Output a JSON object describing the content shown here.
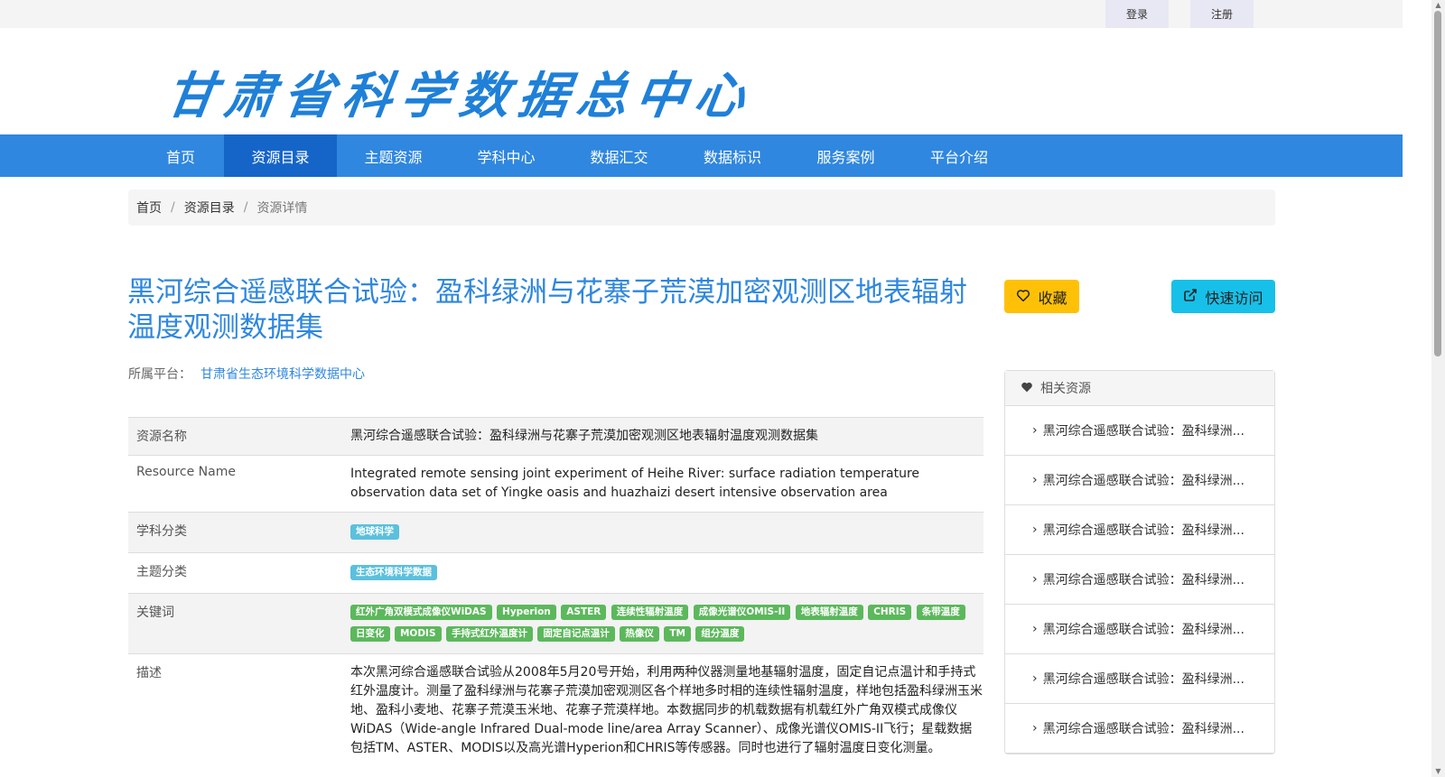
{
  "topbar": {
    "login": "登录",
    "register": "注册"
  },
  "header": {
    "logo_text": "甘肃省科学数据总中心"
  },
  "nav": {
    "items": [
      "首页",
      "资源目录",
      "主题资源",
      "学科中心",
      "数据汇交",
      "数据标识",
      "服务案例",
      "平台介绍"
    ],
    "active_index": 1
  },
  "breadcrumb": {
    "home": "首页",
    "catalog": "资源目录",
    "current": "资源详情"
  },
  "resource": {
    "title": "黑河综合遥感联合试验：盈科绿洲与花寨子荒漠加密观测区地表辐射温度观测数据集",
    "platform_label": "所属平台：",
    "platform_name": "甘肃省生态环境科学数据中心",
    "favorite_label": "收藏",
    "quick_access_label": "快速访问"
  },
  "details": {
    "name_label": "资源名称",
    "name_value": "黑河综合遥感联合试验：盈科绿洲与花寨子荒漠加密观测区地表辐射温度观测数据集",
    "en_label": "Resource Name",
    "en_value": "Integrated remote sensing joint experiment of Heihe River: surface radiation temperature observation data set of Yingke oasis and huazhaizi desert intensive observation area",
    "subject_label": "学科分类",
    "subject_tag": "地球科学",
    "theme_label": "主题分类",
    "theme_tag": "生态环境科学数据",
    "keyword_label": "关键词",
    "keywords": [
      "红外广角双模式成像仪WiDAS",
      "Hyperion",
      "ASTER",
      "连续性辐射温度",
      "成像光谱仪OMIS-II",
      "地表辐射温度",
      "CHRIS",
      "条带温度",
      "日变化",
      "MODIS",
      "手持式红外温度计",
      "固定自记点温计",
      "热像仪",
      "TM",
      "组分温度"
    ],
    "desc_label": "描述",
    "desc_value": "本次黑河综合遥感联合试验从2008年5月20号开始，利用两种仪器测量地基辐射温度，固定自记点温计和手持式红外温度计。测量了盈科绿洲与花寨子荒漠加密观测区各个样地多时相的连续性辐射温度，样地包括盈科绿洲玉米地、盈科小麦地、花寨子荒漠玉米地、花寨子荒漠样地。本数据同步的机载数据有机载红外广角双模式成像仪WiDAS（Wide-angle Infrared Dual-mode line/area Array Scanner）、成像光谱仪OMIS-II飞行；星载数据包括TM、ASTER、MODIS以及高光谱Hyperion和CHRIS等传感器。同时也进行了辐射温度日变化测量。"
  },
  "related": {
    "title": "相关资源",
    "items": [
      "黑河综合遥感联合试验：盈科绿洲...",
      "黑河综合遥感联合试验：盈科绿洲...",
      "黑河综合遥感联合试验：盈科绿洲...",
      "黑河综合遥感联合试验：盈科绿洲...",
      "黑河综合遥感联合试验：盈科绿洲...",
      "黑河综合遥感联合试验：盈科绿洲...",
      "黑河综合遥感联合试验：盈科绿洲..."
    ]
  },
  "colors": {
    "primary": "#2f87df",
    "nav_active": "#1565c9",
    "favorite": "#ffc107",
    "quick_access": "#17c0e8",
    "tag_info": "#5bc0de",
    "tag_success": "#5cb85c"
  },
  "icons": {
    "favorite": "heart-outline-icon",
    "quick_access": "external-link-icon",
    "related": "heart-icon",
    "related_item": "chevron-right-icon"
  }
}
